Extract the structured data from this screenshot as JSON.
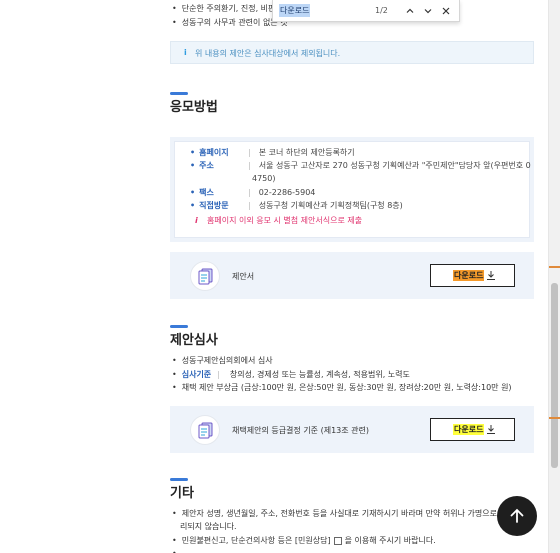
{
  "top_list": [
    "단순한 주의환기, 진정, 비판",
    "성동구의 사무과 관련이 없는 것"
  ],
  "notice": "위 내용의 제안은 심사대상에서 제외됩니다.",
  "find_bar": {
    "query": "다운로드",
    "count": "1/2"
  },
  "apply": {
    "title": "응모방법",
    "rows": [
      {
        "key": "홈페이지",
        "value": "본 코너 하단의 제안등록하기"
      },
      {
        "key": "주소",
        "value": "서울 성동구 고산자로 270 성동구청 기획예산과 \"주민제안\"담당자 앞(우편번호 0"
      },
      {
        "key": "",
        "value": "4750)"
      },
      {
        "key": "팩스",
        "value": "02-2286-5904"
      },
      {
        "key": "직접방문",
        "value": "성동구청 기획예산과 기획정책팀(구청 8층)"
      }
    ],
    "warning": "홈페이지 이외 응모 시 별첨 제안서식으로 제출",
    "download": {
      "label": "제안서",
      "button": "다운로드"
    }
  },
  "review": {
    "title": "제안심사",
    "items": [
      {
        "key": "",
        "value": "성동구제안심의회에서 심사"
      },
      {
        "key": "심사기준",
        "value": "창의성, 경제성 또는 능률성, 계속성, 적용범위, 노력도"
      },
      {
        "key": "",
        "value": "채택 제안 부상금 (금상:100만 원, 은상:50만 원, 동상:30만 원, 장려상:20만 원, 노력상:10만 원)"
      }
    ],
    "download": {
      "label": "채택제안의 등급결정 기준 (제13조 관련)",
      "button": "다운로드"
    }
  },
  "etc": {
    "title": "기타",
    "items": [
      "제안자 성명, 생년월일, 주소, 전화번호 등을 사실대로 기재하시기 바라며 만약 허위나 가명으로 접수",
      "리되지 않습니다.",
      "민원불편신고, 단순건의사항 등은 [민원상담]",
      "을 이용해 주시기 바랍니다."
    ]
  },
  "colors": {
    "accent_blue": "#2b63b7",
    "warning_pink": "#e0326e",
    "highlight_orange": "#f59a2a",
    "highlight_yellow": "#ffff3c"
  }
}
